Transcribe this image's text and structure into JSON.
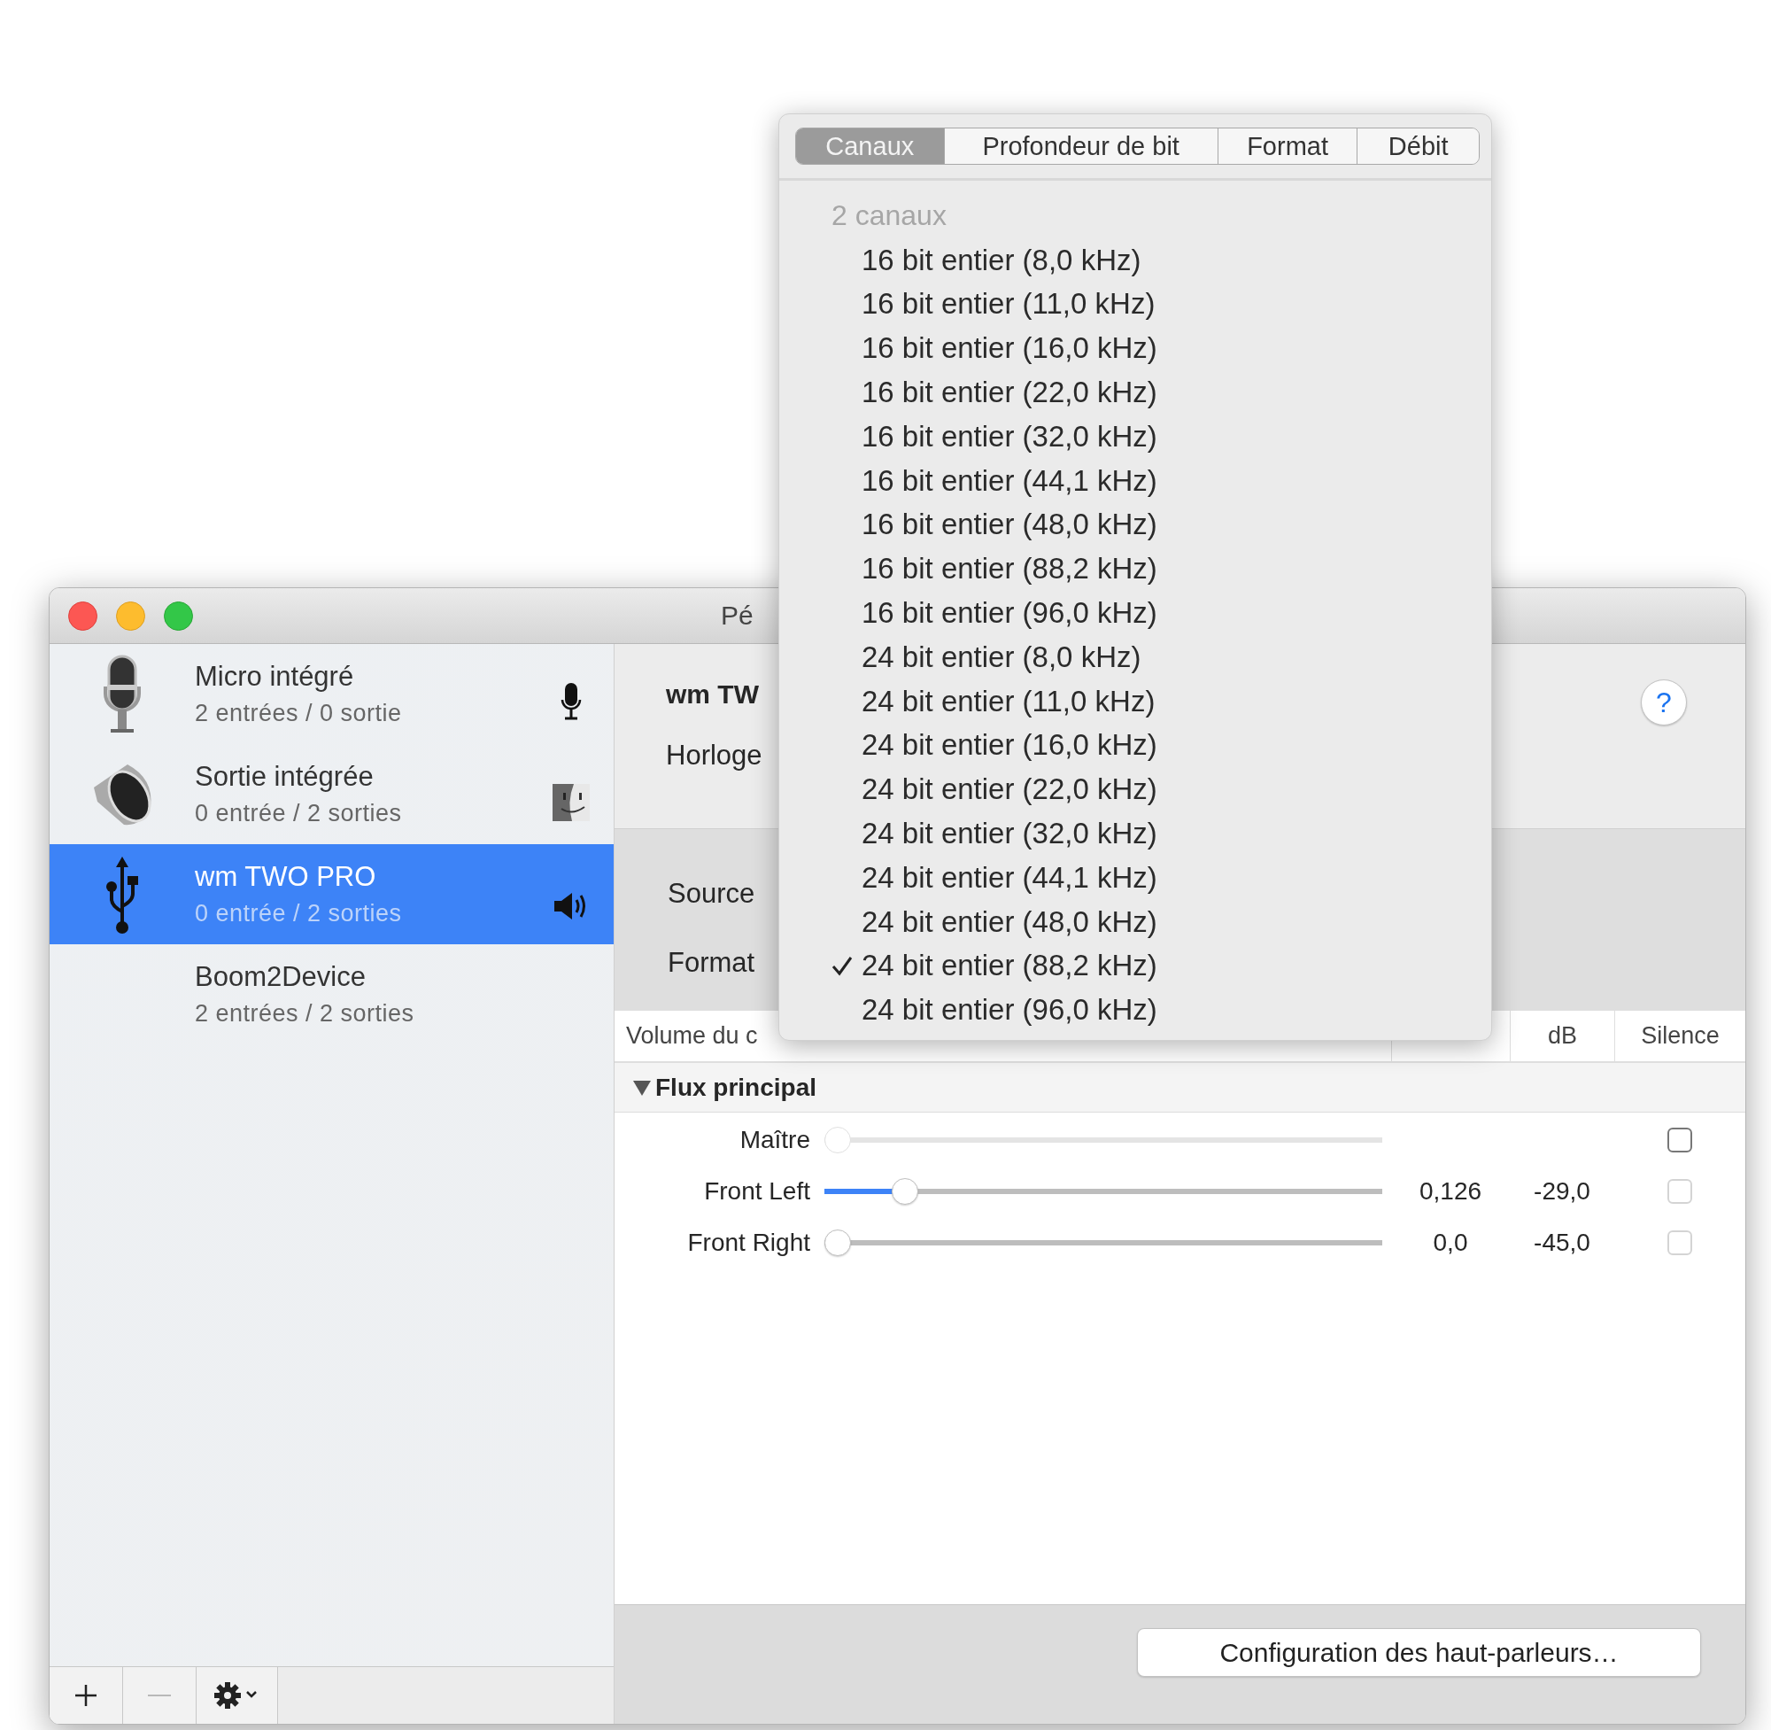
{
  "window": {
    "title": "Pé"
  },
  "sidebar": {
    "items": [
      {
        "name": "Micro intégré",
        "detail": "2 entrées / 0 sortie",
        "kind": "microphone",
        "default_input": true,
        "default_system_output": false,
        "default_output": false,
        "selected": false
      },
      {
        "name": "Sortie intégrée",
        "detail": "0 entrée / 2 sorties",
        "kind": "speaker",
        "default_input": false,
        "default_system_output": true,
        "default_output": false,
        "selected": false
      },
      {
        "name": "wm TWO PRO",
        "detail": "0 entrée / 2 sorties",
        "kind": "usb",
        "default_input": false,
        "default_system_output": false,
        "default_output": true,
        "selected": true
      },
      {
        "name": "Boom2Device",
        "detail": "2 entrées / 2 sorties",
        "kind": "plain",
        "default_input": false,
        "default_system_output": false,
        "default_output": false,
        "selected": false
      }
    ],
    "buttons": [
      {
        "kind": "add",
        "disabled": false
      },
      {
        "kind": "remove",
        "disabled": true
      },
      {
        "kind": "actions",
        "disabled": false
      }
    ]
  },
  "device": {
    "name": "wm TW",
    "clock_label": "Horloge",
    "help": "?"
  },
  "settings": {
    "source_label": "Source",
    "format_label": "Format"
  },
  "table": {
    "columns": [
      {
        "label": "Volume du c"
      },
      {
        "label": "dB"
      },
      {
        "label": "Silence"
      }
    ],
    "group": {
      "label": "Flux principal",
      "expanded": true
    },
    "rows": [
      {
        "label": "Maître",
        "level": 0,
        "slider_disabled": true,
        "checked": false,
        "checkbox_disabled": false
      },
      {
        "label": "Front Left",
        "level": 0.126,
        "value": "0,126",
        "db": "-29,0",
        "slider_disabled": false,
        "checked": false,
        "checkbox_disabled": true
      },
      {
        "label": "Front Right",
        "level": 0,
        "value": "0,0",
        "db": "-45,0",
        "slider_disabled": false,
        "checked": false,
        "checkbox_disabled": true
      }
    ]
  },
  "footer": {
    "button": "Configuration des haut-parleurs…"
  },
  "menu": {
    "tabs": [
      {
        "label": "Canaux",
        "selected": true
      },
      {
        "label": "Profondeur de bit",
        "selected": false
      },
      {
        "label": "Format",
        "selected": false
      },
      {
        "label": "Débit",
        "selected": false
      }
    ],
    "section": "2 canaux",
    "items": [
      {
        "label": "16 bit entier (8,0 kHz)",
        "checked": false
      },
      {
        "label": "16 bit entier (11,0 kHz)",
        "checked": false
      },
      {
        "label": "16 bit entier (16,0 kHz)",
        "checked": false
      },
      {
        "label": "16 bit entier (22,0 kHz)",
        "checked": false
      },
      {
        "label": "16 bit entier (32,0 kHz)",
        "checked": false
      },
      {
        "label": "16 bit entier (44,1 kHz)",
        "checked": false
      },
      {
        "label": "16 bit entier (48,0 kHz)",
        "checked": false
      },
      {
        "label": "16 bit entier (88,2 kHz)",
        "checked": false
      },
      {
        "label": "16 bit entier (96,0 kHz)",
        "checked": false
      },
      {
        "label": "24 bit entier (8,0 kHz)",
        "checked": false
      },
      {
        "label": "24 bit entier (11,0 kHz)",
        "checked": false
      },
      {
        "label": "24 bit entier (16,0 kHz)",
        "checked": false
      },
      {
        "label": "24 bit entier (22,0 kHz)",
        "checked": false
      },
      {
        "label": "24 bit entier (32,0 kHz)",
        "checked": false
      },
      {
        "label": "24 bit entier (44,1 kHz)",
        "checked": false
      },
      {
        "label": "24 bit entier (48,0 kHz)",
        "checked": false
      },
      {
        "label": "24 bit entier (88,2 kHz)",
        "checked": true
      },
      {
        "label": "24 bit entier (96,0 kHz)",
        "checked": false
      }
    ]
  }
}
